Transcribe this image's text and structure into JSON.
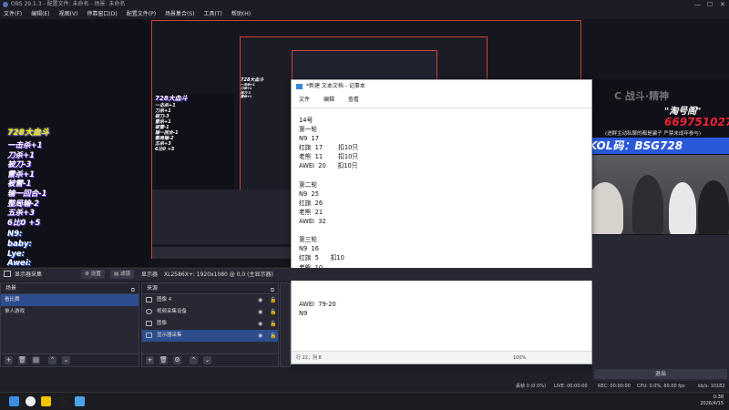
{
  "obs": {
    "title": "OBS 29.1.3 - 配置文件: 未命名 - 场景: 未命名",
    "menu": [
      "文件(F)",
      "编辑(E)",
      "视图(V)",
      "停靠窗口(D)",
      "配置文件(P)",
      "场景集合(S)",
      "工具(T)",
      "帮助(H)"
    ]
  },
  "overlay": {
    "title": "728大血斗",
    "lines": [
      "一击杀+1",
      "刀杀+1",
      "被刀-3",
      "雷杀+1",
      "被雷-1",
      "输一回合-1",
      "整局输-2",
      "五杀+3",
      "6比0 +5"
    ],
    "nicks": [
      "N9:",
      "baby:",
      "Lye:",
      "Awei:"
    ]
  },
  "promo": {
    "line1": "C  战斗·精神",
    "brand": "\"淘号阁\"",
    "number": "669751027",
    "warning": "(进群主动私聊的都是骗子 严禁未成年参与)",
    "kol": "KOL码：BSG728"
  },
  "notepad": {
    "title": "*新建 文本文档 - 记事本",
    "menu": [
      "文件",
      "编辑",
      "查看"
    ],
    "body": "14号\n第一轮\nN9  17\n红旗  17        扣10只\n老熊  11        扣10只\nAWEI  20      扣10只\n\n第二轮\nN9  25\n红旗  26\n老熊  21\nAWEI  32\n\n第三轮\nN9  16\n红旗  5      扣10\n老熊  10\nAWEI  27      扣10\n\n\nAWEI  79-20\nN9",
    "status": "行 22，列 8",
    "zoom": "100%"
  },
  "dock": {
    "display_source": "显示器采集",
    "settings_btn": "设置",
    "filter_btn": "滤镜",
    "display_label": "显示器",
    "display_value": "XL2586X+: 1920x1080 @ 0,0 (主显示器)",
    "scenes_header": "场景",
    "scenes": [
      "看比赛",
      "单人游戏"
    ],
    "sources_header": "来源",
    "sources": [
      {
        "name": "图像 4"
      },
      {
        "name": "视频采集设备"
      },
      {
        "name": "图像"
      },
      {
        "name": "显示器采集"
      }
    ],
    "exit_label": "退出"
  },
  "status": {
    "dropped": "丢帧 0 (0.0%)",
    "live": "LIVE: 00:00:00",
    "rec": "REC: 00:00:00",
    "cpu": "CPU: 0.0%, 60.00 fps",
    "kbps": "kb/s: 10182"
  },
  "clock": {
    "time": "0:38",
    "date": "2026/4/15"
  }
}
